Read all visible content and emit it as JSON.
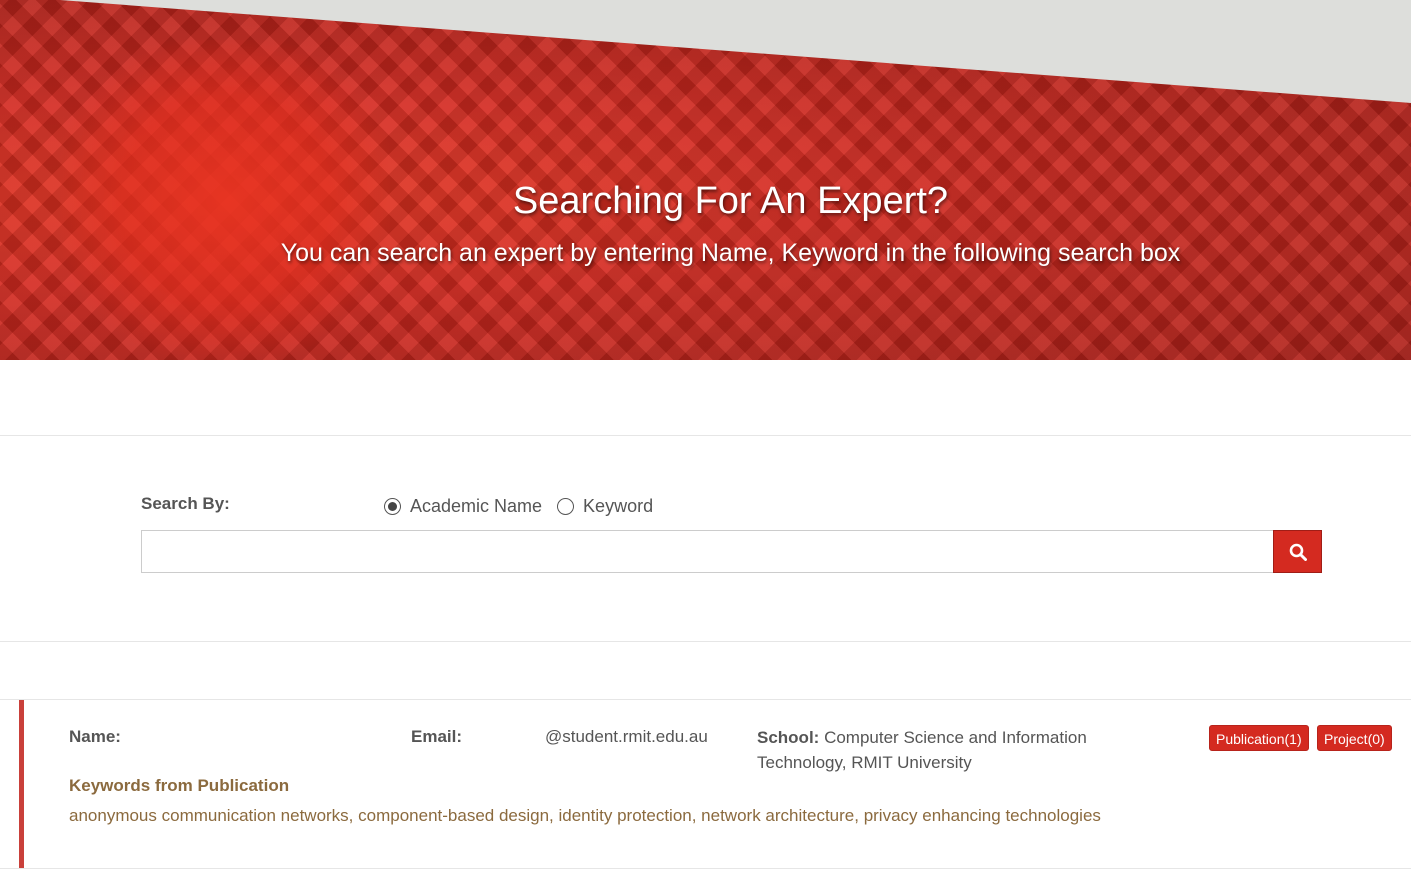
{
  "hero": {
    "title": "Searching For An Expert?",
    "subtitle": "You can search an expert by entering Name, Keyword in the following search box"
  },
  "search": {
    "label": "Search By:",
    "options": [
      {
        "label": "Academic Name",
        "selected": true
      },
      {
        "label": "Keyword",
        "selected": false
      }
    ],
    "input_value": "",
    "button_icon": "search-icon"
  },
  "result": {
    "name_label": "Name:",
    "name_value": "",
    "email_label": "Email:",
    "email_value": "@student.rmit.edu.au",
    "school_label": "School:",
    "school_value": "Computer Science and Information Technology, RMIT University",
    "publication_button": "Publication(1)",
    "project_button": "Project(0)",
    "keywords_title": "Keywords from Publication",
    "keywords": "anonymous communication networks, component-based design, identity protection, network architecture, privacy enhancing technologies"
  },
  "colors": {
    "brand_red": "#d42a20",
    "keyword_brown": "#8b6a3e",
    "card_accent": "#c9403a"
  }
}
